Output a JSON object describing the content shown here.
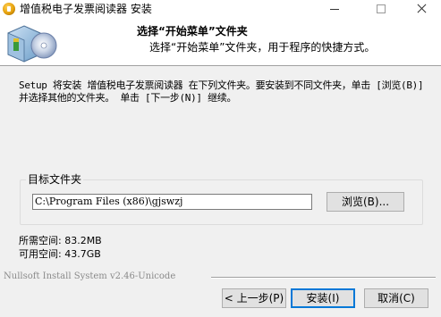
{
  "window": {
    "title": "增值税电子发票阅读器 安装",
    "minimize_label": "—",
    "maximize_label": "□",
    "close_label": "✕"
  },
  "header": {
    "title": "选择“开始菜单”文件夹",
    "subtitle": "选择“开始菜单”文件夹，用于程序的快捷方式。"
  },
  "body": {
    "description": "Setup 将安装 增值税电子发票阅读器 在下列文件夹。要安装到不同文件夹，单击 [浏览(B)] 并选择其他的文件夹。 单击 [下一步(N)] 继续。",
    "target_folder_label": "目标文件夹",
    "install_path": "C:\\Program Files (x86)\\gjswzj",
    "browse_label": "浏览(B)...",
    "space_required_label": "所需空间: 83.2MB",
    "space_available_label": "可用空间: 43.7GB"
  },
  "footer": {
    "branding": "Nullsoft Install System v2.46-Unicode",
    "back_label": "< 上一步(P)",
    "install_label": "安装(I)",
    "cancel_label": "取消(C)"
  },
  "colors": {
    "focus_border": "#0078d7",
    "dialog_bg": "#f0f0f0"
  }
}
